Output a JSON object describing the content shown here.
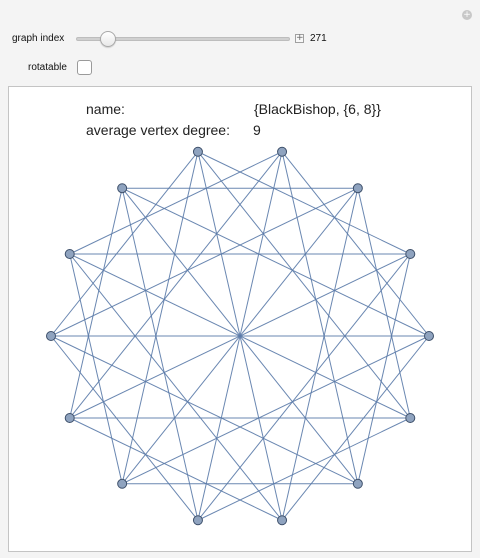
{
  "controls": {
    "graph_index_label": "graph index",
    "graph_index_value": "271",
    "graph_index_position": 0.08,
    "rotatable_label": "rotatable",
    "rotatable_checked": false
  },
  "info": {
    "name_label": "name:",
    "name_value": "{BlackBishop, {6, 8}}",
    "degree_label": "average vertex degree:",
    "degree_value": "9"
  },
  "graph": {
    "vertex_count": 14,
    "edge_color": "#5a7aa8",
    "vertex_fill": "#8fa3bf",
    "vertex_stroke": "#3d4f6a"
  }
}
